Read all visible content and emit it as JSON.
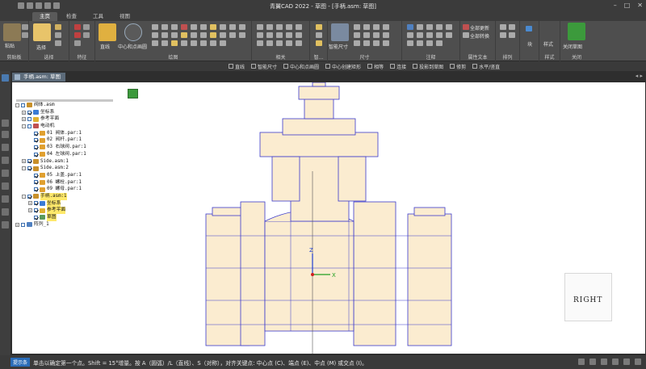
{
  "window": {
    "title": "青翼CAD 2022 - 草图 - [手柄.asm: 草图]"
  },
  "tabs": [
    {
      "label": "主页",
      "active": true
    },
    {
      "label": "检查",
      "active": false
    },
    {
      "label": "工具",
      "active": false
    },
    {
      "label": "视图",
      "active": false
    }
  ],
  "ribbon": {
    "groups": [
      {
        "label": "剪贴板"
      },
      {
        "label": "选择"
      },
      {
        "label": "特征"
      },
      {
        "label": "绘图"
      },
      {
        "label": "相关"
      },
      {
        "label": "智..."
      },
      {
        "label": "尺寸"
      },
      {
        "label": "注释"
      },
      {
        "label": "属性文本"
      },
      {
        "label": "排列"
      },
      {
        "label": "样式"
      },
      {
        "label": "关闭"
      }
    ],
    "paste_label": "粘贴",
    "select_label": "选择",
    "line_label": "直线",
    "center_circle_label": "中心和点画圆",
    "smart_dim_label": "智能尺寸",
    "update_all_label": "全部更新",
    "convert_all_label": "全部转换",
    "block_label": "块",
    "style_label": "样式",
    "close_sketch_label": "关闭草图"
  },
  "command_bar": {
    "items": [
      "直线",
      "智能尺寸",
      "中心和点画圆",
      "中心创建矩形",
      "相等",
      "连接",
      "投影到草图",
      "修剪",
      "水平/竖直"
    ]
  },
  "document": {
    "tab_label": "手柄.asm: 草图",
    "nav": "◂ ▸"
  },
  "tree": {
    "rows": [
      {
        "label": "阀体.asm",
        "indent": 0,
        "exp": "-",
        "check": false,
        "icon": "#c8902a",
        "hl": false
      },
      {
        "label": "坐标系",
        "indent": 1,
        "exp": "+",
        "check": true,
        "icon": "#3a7bd5",
        "hl": false
      },
      {
        "label": "参考平面",
        "indent": 1,
        "exp": "+",
        "check": false,
        "icon": "#e0b030",
        "hl": false
      },
      {
        "label": "电动机",
        "indent": 1,
        "exp": "-",
        "check": false,
        "icon": "#c05050",
        "hl": false
      },
      {
        "label": "01 阀体.par:1",
        "indent": 2,
        "exp": "",
        "check": true,
        "icon": "#e0a030",
        "hl": false
      },
      {
        "label": "02 阀杆.par:1",
        "indent": 2,
        "exp": "",
        "check": true,
        "icon": "#e0a030",
        "hl": false
      },
      {
        "label": "03 右球阀.par:1",
        "indent": 2,
        "exp": "",
        "check": true,
        "icon": "#e0a030",
        "hl": false
      },
      {
        "label": "04 左球阀.par:1",
        "indent": 2,
        "exp": "",
        "check": true,
        "icon": "#e0a030",
        "hl": false
      },
      {
        "label": "Side.asm:1",
        "indent": 1,
        "exp": "+",
        "check": true,
        "icon": "#c8902a",
        "hl": false
      },
      {
        "label": "Side.asm:2",
        "indent": 1,
        "exp": "-",
        "check": true,
        "icon": "#c8902a",
        "hl": false
      },
      {
        "label": "05 上盖.par:1",
        "indent": 2,
        "exp": "",
        "check": true,
        "icon": "#e0a030",
        "hl": false
      },
      {
        "label": "06 螺栓.par:1",
        "indent": 2,
        "exp": "",
        "check": true,
        "icon": "#e0a030",
        "hl": false
      },
      {
        "label": "09 螺母.par:1",
        "indent": 2,
        "exp": "",
        "check": true,
        "icon": "#e0a030",
        "hl": false
      },
      {
        "label": "手柄.asm:1",
        "indent": 1,
        "exp": "-",
        "check": true,
        "icon": "#c8902a",
        "hl": true
      },
      {
        "label": "坐标系",
        "indent": 2,
        "exp": "+",
        "check": true,
        "icon": "#3a7bd5",
        "hl": true
      },
      {
        "label": "参考平面",
        "indent": 2,
        "exp": "+",
        "check": true,
        "icon": "#e0b030",
        "hl": true
      },
      {
        "label": "草图",
        "indent": 2,
        "exp": "",
        "check": true,
        "icon": "#5a9a5a",
        "hl": true
      },
      {
        "label": "阵列_1",
        "indent": 0,
        "exp": "+",
        "check": false,
        "icon": "#5080c0",
        "hl": false
      }
    ]
  },
  "axes": {
    "z": "Z",
    "x": "X"
  },
  "view_cube_label": "RIGHT",
  "status": {
    "prompt_label": "提示条",
    "prompt_text": "单击以确定第一个点。Shift = 15°增量。按 A（圆弧）/L（直线）、S（对称），对齐关键点: 中心点 (C)、端点 (E)、中点 (M) 或交点 (I)。"
  },
  "colors": {
    "drawing_line": "#3a3acc",
    "drawing_fill": "#fbecd0",
    "axis_z": "#2040d0",
    "axis_x": "#20a020"
  }
}
